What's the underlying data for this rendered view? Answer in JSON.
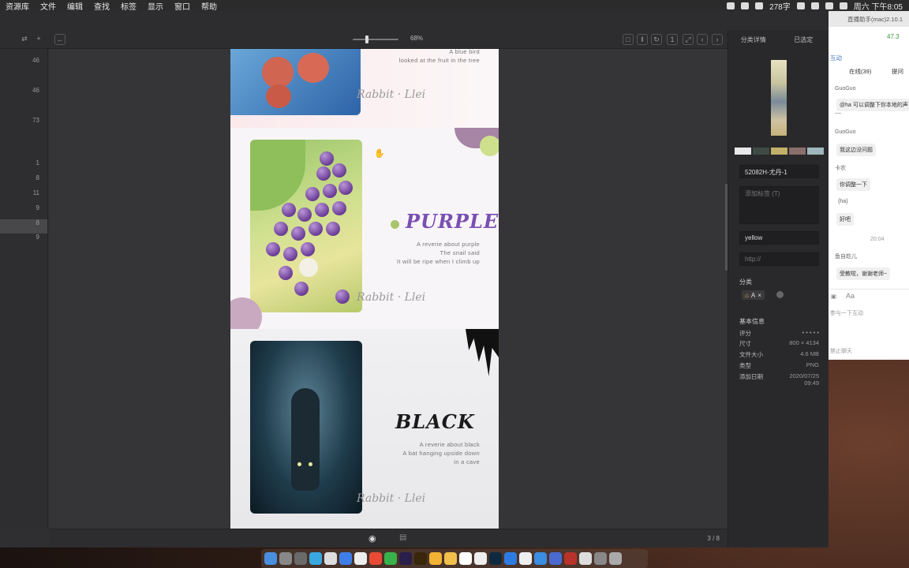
{
  "menubar": {
    "items": [
      "资源库",
      "文件",
      "编辑",
      "查找",
      "标签",
      "显示",
      "窗口",
      "帮助"
    ],
    "word_count": "278字",
    "clock": "周六 下午8:05"
  },
  "toolbar": {
    "zoom": "68%",
    "zoom_level": 0.68
  },
  "gutter": {
    "numbers": [
      "46",
      "46",
      "73",
      "1",
      "8",
      "11",
      "9",
      "8",
      "9"
    ]
  },
  "document": {
    "section1": {
      "caption_line1": "A blue bird",
      "caption_line2": "looked at the fruit in the tree",
      "signature": "Rabbit · Llei"
    },
    "section2": {
      "heading": "PURPLE",
      "line1": "A reverie about purple",
      "line2": "The snail said",
      "line3": "It will be ripe when I climb up",
      "signature": "Rabbit · Llei"
    },
    "section3": {
      "heading": "BLACK",
      "line1": "A reverie about black",
      "line2": "A bat hanging upside down",
      "line3": "in a cave",
      "signature": "Rabbit · Llei"
    }
  },
  "right_panel": {
    "tab_details": "分类详情",
    "tab_selected": "已选定",
    "swatch_colors": [
      "#e8e8e8",
      "#3f4a45",
      "#c2b06a",
      "#8a6e6a",
      "#9fb7bd"
    ],
    "filename": "52082H-尤丹-1",
    "tags_placeholder": "添加标签 (T)",
    "note": "yellow",
    "url_placeholder": "http://",
    "category_title": "分类",
    "category_tag": "A",
    "basic_info_title": "基本信息",
    "info": [
      {
        "label": "评分",
        "value": "• • • • •"
      },
      {
        "label": "尺寸",
        "value": "800 × 4134"
      },
      {
        "label": "文件大小",
        "value": "4.6 MB"
      },
      {
        "label": "类型",
        "value": "PNG"
      },
      {
        "label": "添加日期",
        "value": "2020/07/25 09:49"
      }
    ]
  },
  "bottom_bar": {
    "page": "3 / 8"
  },
  "chat": {
    "title": "直播助手(mac)2.10.1",
    "signal": "47.3",
    "section": "互动",
    "tab_online": "在线(39)",
    "tab_question": "提问",
    "messages": [
      {
        "name": "GuoGuo",
        "text": "@ha 可以调整下你本地的声"
      },
      {
        "name": "",
        "text": "~~"
      },
      {
        "name": "GuoGuo",
        "text": "我这边没问题"
      },
      {
        "name": "卡农",
        "text": "你调整一下"
      },
      {
        "name": "",
        "text": "{ha}"
      },
      {
        "name": "",
        "text": "好吧"
      }
    ],
    "time": "20:04",
    "last_name": "鱼自趁儿",
    "last_text": "受教啦，谢谢老师~",
    "input_hint": "参与一下互动",
    "bottom_hint": "禁止聊天"
  }
}
